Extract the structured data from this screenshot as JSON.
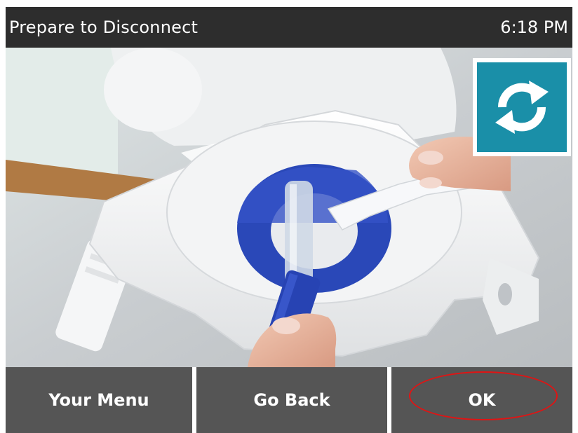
{
  "header": {
    "title": "Prepare to Disconnect",
    "time": "6:18 PM"
  },
  "illustration": {
    "description_icon": "disconnect-illustration"
  },
  "refresh_button": {
    "icon": "refresh-icon",
    "color": "#1a8fa8"
  },
  "footer": {
    "menu_label": "Your Menu",
    "back_label": "Go Back",
    "ok_label": "OK"
  },
  "colors": {
    "header_bg": "#2d2d2d",
    "button_bg": "#555555",
    "accent": "#1a8fa8",
    "highlight": "#e01414"
  }
}
